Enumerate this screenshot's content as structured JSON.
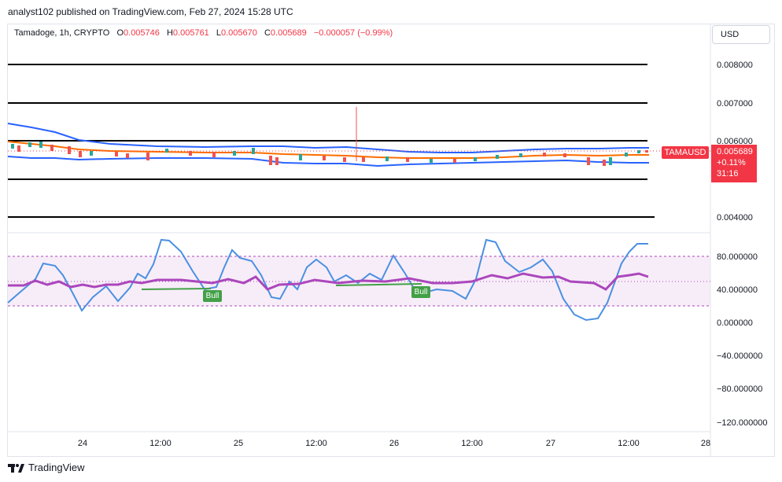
{
  "header": {
    "publisher_line": "analyst102 published on TradingView.com, Feb 27, 2024 15:28 UTC"
  },
  "legend": {
    "symbol": "Tamadoge, 1h, CRYPTO",
    "o_label": "O",
    "o_value": "0.005746",
    "h_label": "H",
    "h_value": "0.005761",
    "l_label": "L",
    "l_value": "0.005670",
    "c_label": "C",
    "c_value": "0.005689",
    "change": "−0.000057 (−0.99%)"
  },
  "currency_button": "USD",
  "price_axis": [
    "0.008000",
    "0.007000",
    "0.006000",
    "0.004000"
  ],
  "indicator_axis": [
    "80.000000",
    "40.000000",
    "0.000000",
    "−40.000000",
    "−80.000000",
    "−120.000000"
  ],
  "time_axis": [
    "24",
    "12:00",
    "25",
    "12:00",
    "26",
    "12:00",
    "27",
    "12:00",
    "28"
  ],
  "price_tag": {
    "symbol": "TAMAUSD",
    "price": "0.005689",
    "change": "+0.11%",
    "countdown": "31:16"
  },
  "bull_labels": [
    "Bull",
    "Bull"
  ],
  "footer": {
    "brand": "TradingView"
  },
  "colors": {
    "up": "#26a69a",
    "down": "#ef5350",
    "band": "#2962ff",
    "ma": "#ff6d00",
    "rsi": "#ab47bc",
    "stoch": "#4a90e2"
  }
}
